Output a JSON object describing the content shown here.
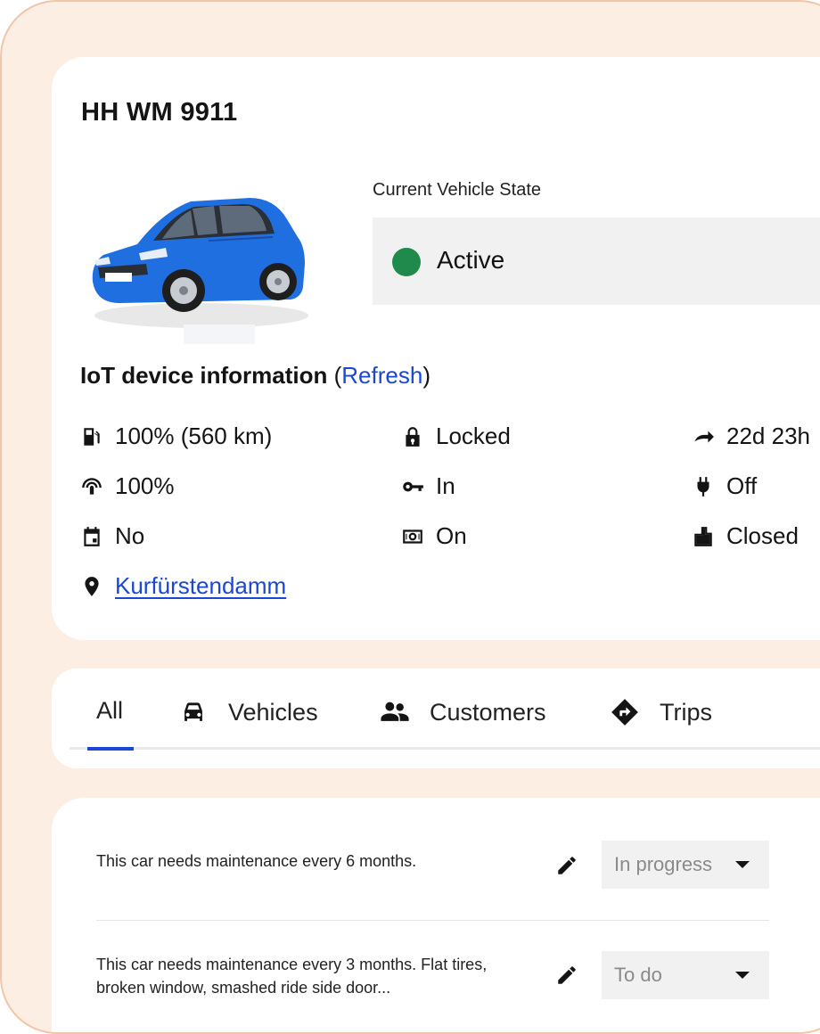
{
  "vehicle": {
    "plate": "HH WM 9911",
    "car_color": "#1f6fe0",
    "state_label": "Current Vehicle State",
    "state": "Active",
    "state_color": "#1f8a4c"
  },
  "iot": {
    "title": "IoT device information",
    "paren_open": "(",
    "refresh": "Refresh",
    "paren_close": ")",
    "fuel": {
      "icon": "fuel-pump-icon",
      "value": "100% (560 km)"
    },
    "lock": {
      "icon": "lock-icon",
      "value": "Locked"
    },
    "mileage": {
      "icon": "redo-arrow-icon",
      "value": "22d 23h"
    },
    "signal": {
      "icon": "signal-icon",
      "value": "100%"
    },
    "key": {
      "icon": "key-icon",
      "value": "In"
    },
    "charging": {
      "icon": "plug-icon",
      "value": "Off"
    },
    "booking": {
      "icon": "calendar-icon",
      "value": "No"
    },
    "engine": {
      "icon": "engine-icon",
      "value": "On"
    },
    "doors": {
      "icon": "door-icon",
      "value": "Closed"
    },
    "location": {
      "icon": "location-pin-icon",
      "value": "Kurfürstendamm"
    }
  },
  "tabs": [
    {
      "label": "All",
      "active": true
    },
    {
      "label": "Vehicles",
      "icon": "car-icon"
    },
    {
      "label": "Customers",
      "icon": "people-icon"
    },
    {
      "label": "Trips",
      "icon": "directions-icon"
    }
  ],
  "accent": "#1a47d6",
  "tasks": [
    {
      "text": "This car needs maintenance every 6 months.",
      "status": "In progress"
    },
    {
      "text": "This car needs maintenance every 3 months. Flat tires, broken window, smashed ride side door...",
      "status": "To do"
    }
  ]
}
